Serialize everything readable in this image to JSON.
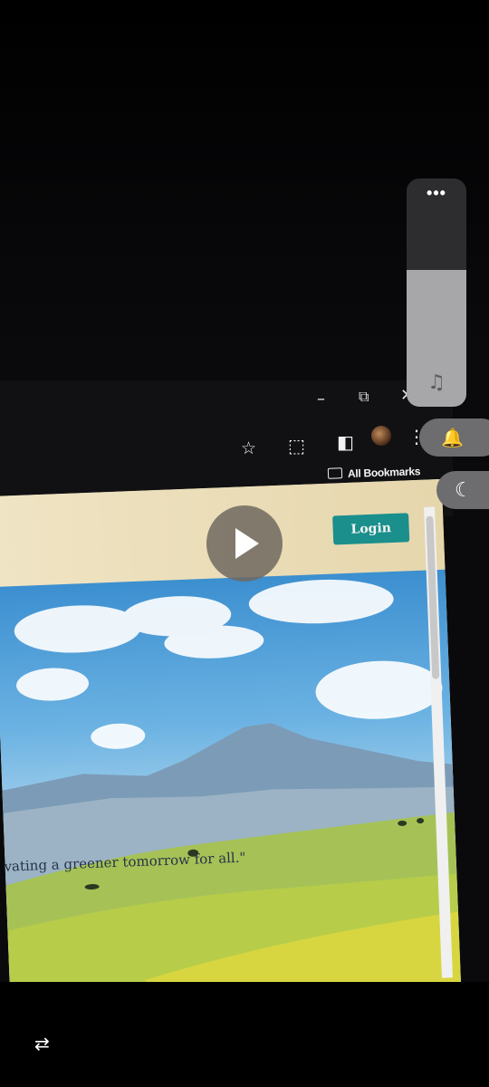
{
  "window_controls": {
    "minimize": "–",
    "restore": "⧉",
    "close": "✕"
  },
  "toolbar": {
    "bookmark_star": "☆",
    "extensions_icon": "⬚",
    "sidebar_icon": "◧",
    "menu_icon": "⋮",
    "bookmarks_label": "All Bookmarks"
  },
  "webpage": {
    "login_label": "Login",
    "quote_text": "ivating a greener tomorrow for all.\""
  },
  "overlay": {
    "volume_more": "•••",
    "volume_level": 0.6,
    "music_note": "♫",
    "bell": "🔔",
    "moon": "☾",
    "repeat": "⇄"
  },
  "colors": {
    "login_button": "#1a8f8c",
    "header_bg": "#e9dcb7",
    "overlay_pill": "#6d6d6f"
  }
}
